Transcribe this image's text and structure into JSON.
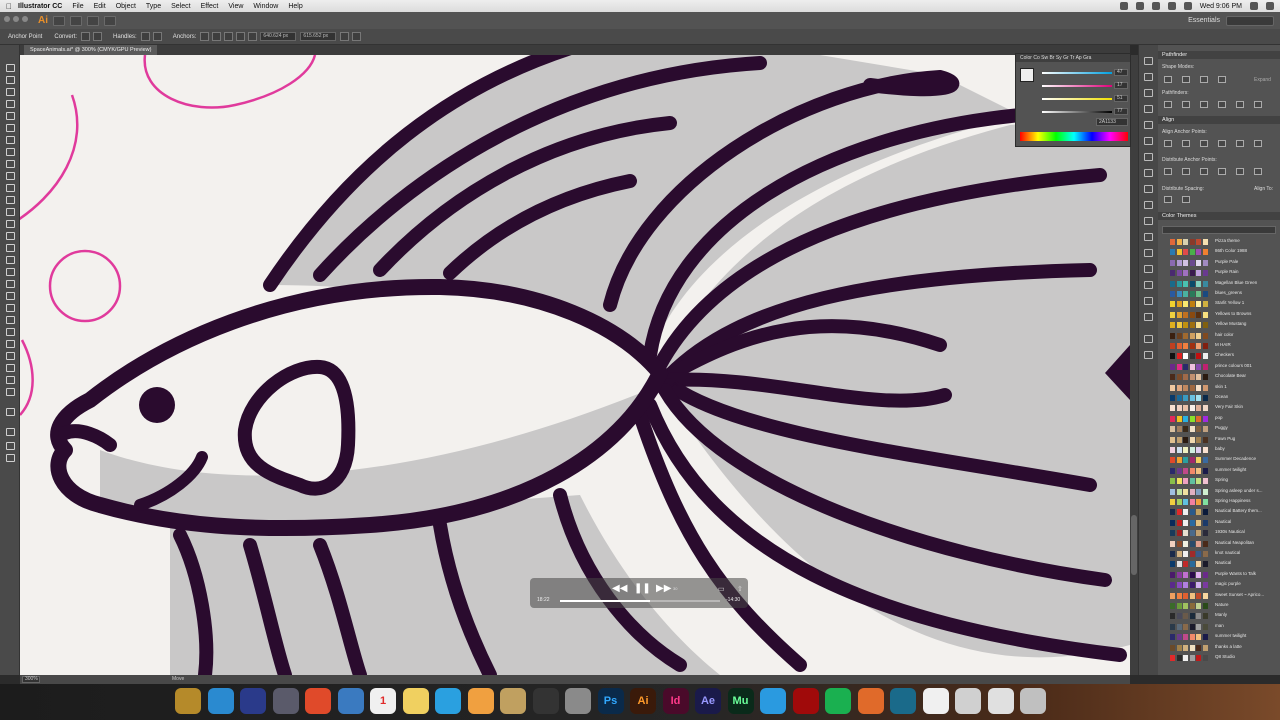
{
  "menubar": {
    "app_name": "Illustrator CC",
    "items": [
      "File",
      "Edit",
      "Object",
      "Type",
      "Select",
      "Effect",
      "View",
      "Window",
      "Help"
    ],
    "clock": "Wed 9:06 PM"
  },
  "appbar": {
    "logo": "Ai",
    "workspace": "Essentials"
  },
  "controlbar": {
    "anchor_point": "Anchor Point",
    "convert": "Convert:",
    "handles": "Handles:",
    "anchors": "Anchors:",
    "x_value": "640.624 px",
    "y_value": "615.652 px"
  },
  "document": {
    "tab_title": "SpaceAnimals.ai* @ 300% (CMYK/GPU Preview)",
    "zoom": "300%",
    "status_mode": "Move"
  },
  "color_panel": {
    "tabs": "Color  Co  Sw  Br  Sy  Gr  Tr  Ap  Gra",
    "hex": "2A1133",
    "values": [
      "47",
      "17",
      "51",
      "77"
    ]
  },
  "pathfinder": {
    "title": "Pathfinder",
    "shape_modes": "Shape Modes:",
    "expand": "Expand",
    "pathfinders": "Pathfinders:"
  },
  "align": {
    "title": "Align",
    "align_anchor": "Align Anchor Points:",
    "distribute_anchor": "Distribute Anchor Points:",
    "distribute_spacing": "Distribute Spacing:",
    "align_to": "Align To:"
  },
  "color_themes": {
    "title": "Color Themes",
    "themes": [
      {
        "name": "Pizza theme",
        "colors": [
          "#e0683a",
          "#f0b04a",
          "#d8d0b0",
          "#8a3a2a",
          "#c04a30",
          "#f4e0b0"
        ]
      },
      {
        "name": "86th Color 1988",
        "colors": [
          "#2a7ab0",
          "#f0c030",
          "#e04a4a",
          "#4ab04a",
          "#a04ab0",
          "#f08030"
        ]
      },
      {
        "name": "Purple Pale",
        "colors": [
          "#8a6ab0",
          "#b09ad0",
          "#d0c0e0",
          "#6a4a90",
          "#e0d8f0",
          "#a08ac0"
        ]
      },
      {
        "name": "Purple Rain",
        "colors": [
          "#4a2a70",
          "#7a4aa0",
          "#a070c0",
          "#3a1a50",
          "#c0a0e0",
          "#6a3a90"
        ]
      },
      {
        "name": "Magellan Blue Green",
        "colors": [
          "#1a6a8a",
          "#2a9aa0",
          "#4ac0b0",
          "#0a4a6a",
          "#80d0c0",
          "#3a8aa0"
        ]
      },
      {
        "name": "blues_greens",
        "colors": [
          "#2a5aa0",
          "#3a8ac0",
          "#4ab0a0",
          "#2a7a5a",
          "#6ac08a",
          "#1a4a80"
        ]
      },
      {
        "name": "Starlit Yellow 1",
        "colors": [
          "#f0d030",
          "#e0a020",
          "#f8e870",
          "#c08010",
          "#fff0a0",
          "#d0b040"
        ]
      },
      {
        "name": "Yellows to Browns",
        "colors": [
          "#f0d040",
          "#e0a030",
          "#c07020",
          "#8a4a10",
          "#5a3010",
          "#f8e080"
        ]
      },
      {
        "name": "Yellow Mustang",
        "colors": [
          "#e0b020",
          "#f0c840",
          "#c09010",
          "#a07010",
          "#f8e090",
          "#806010"
        ]
      },
      {
        "name": "hair color",
        "colors": [
          "#3a2010",
          "#6a4020",
          "#a06a30",
          "#d0a060",
          "#f0d090",
          "#804a20"
        ]
      },
      {
        "name": "M HAIR",
        "colors": [
          "#c04020",
          "#e06030",
          "#f08040",
          "#a03010",
          "#f0a070",
          "#802010"
        ]
      },
      {
        "name": "Checkers",
        "colors": [
          "#111111",
          "#e02020",
          "#ffffff",
          "#333333",
          "#c01010",
          "#eeeeee"
        ]
      },
      {
        "name": "prince colours 001",
        "colors": [
          "#6a2a8a",
          "#e02a8a",
          "#2a2a6a",
          "#f0c0e0",
          "#8a4ab0",
          "#c02070"
        ]
      },
      {
        "name": "Chocolate Bear",
        "colors": [
          "#4a2a1a",
          "#7a4a2a",
          "#a06a4a",
          "#c09070",
          "#e0c0a0",
          "#2a1a10"
        ]
      },
      {
        "name": "skin 1",
        "colors": [
          "#f0c8a0",
          "#e0a880",
          "#c08860",
          "#a06840",
          "#f8e0c8",
          "#d09870"
        ]
      },
      {
        "name": "Ocean",
        "colors": [
          "#0a3a6a",
          "#1a6a9a",
          "#3a9ac0",
          "#6ac0e0",
          "#a0e0f0",
          "#0a2a4a"
        ]
      },
      {
        "name": "Very Fair Skin",
        "colors": [
          "#f8e0d0",
          "#f0d0c0",
          "#e8c0a8",
          "#f8f0e8",
          "#e0b098",
          "#f0d8c8"
        ]
      },
      {
        "name": "pop",
        "colors": [
          "#e02a5a",
          "#f0c020",
          "#2ab0e0",
          "#8ae02a",
          "#e06a2a",
          "#a02ae0"
        ]
      },
      {
        "name": "Puggy",
        "colors": [
          "#d8c0a0",
          "#a08060",
          "#3a2a1a",
          "#f0e0c8",
          "#806040",
          "#c0a080"
        ]
      },
      {
        "name": "Fawn Pug",
        "colors": [
          "#e0c090",
          "#c0a070",
          "#2a1a10",
          "#f0d8b0",
          "#a08050",
          "#4a3020"
        ]
      },
      {
        "name": "baby",
        "colors": [
          "#f0d0e0",
          "#d0e0f0",
          "#f0f0c0",
          "#d0f0e0",
          "#e0d0f0",
          "#f8e0d0"
        ]
      },
      {
        "name": "Summer Decadence",
        "colors": [
          "#e04a2a",
          "#f0a030",
          "#2aa0a0",
          "#a02a6a",
          "#f0d060",
          "#3a6aa0"
        ]
      },
      {
        "name": "summer twilight",
        "colors": [
          "#2a2a6a",
          "#6a3a8a",
          "#c04a8a",
          "#f08a6a",
          "#f0c080",
          "#1a1a4a"
        ]
      },
      {
        "name": "Spring",
        "colors": [
          "#8ac04a",
          "#f0e060",
          "#f0a0c0",
          "#60c0a0",
          "#c0e080",
          "#f0c0d0"
        ]
      },
      {
        "name": "Spring asleep under s...",
        "colors": [
          "#a0c0e0",
          "#c0e0a0",
          "#f0e0a0",
          "#e0b0c0",
          "#80a0c0",
          "#d0f0d0"
        ]
      },
      {
        "name": "Spring Happiness",
        "colors": [
          "#f0d040",
          "#a0d060",
          "#60c0e0",
          "#f080a0",
          "#f0a040",
          "#80e0a0"
        ]
      },
      {
        "name": "Nautical Battery them...",
        "colors": [
          "#1a2a4a",
          "#e02a2a",
          "#f0f0f0",
          "#2a5a8a",
          "#c0a060",
          "#0a1a3a"
        ]
      },
      {
        "name": "Nautical",
        "colors": [
          "#0a2a5a",
          "#c02020",
          "#f0f0f0",
          "#2a6aa0",
          "#e0c080",
          "#1a3a6a"
        ]
      },
      {
        "name": "1930s Nautical",
        "colors": [
          "#1a3a5a",
          "#a02020",
          "#e8e0d0",
          "#4a6a8a",
          "#c0a070",
          "#2a2a3a"
        ]
      },
      {
        "name": "Nautical Neapolitan",
        "colors": [
          "#f0d0c0",
          "#8a4a2a",
          "#f0f0e0",
          "#2a4a6a",
          "#e0a090",
          "#4a2a1a"
        ]
      },
      {
        "name": "knot nautical",
        "colors": [
          "#1a2a4a",
          "#d0b080",
          "#f0f0f0",
          "#a02a2a",
          "#3a5a8a",
          "#8a6a4a"
        ]
      },
      {
        "name": "Nautical",
        "colors": [
          "#0a3a6a",
          "#e0e0e0",
          "#c02a2a",
          "#2a6a9a",
          "#f0d0a0",
          "#1a1a2a"
        ]
      },
      {
        "name": "Purple Wants to Talk",
        "colors": [
          "#4a1a6a",
          "#8a3aa0",
          "#c070d0",
          "#2a0a4a",
          "#e0b0f0",
          "#6a2a8a"
        ]
      },
      {
        "name": "magic purple",
        "colors": [
          "#5a2a8a",
          "#8a4ac0",
          "#b080e0",
          "#3a1a6a",
          "#d0b0f0",
          "#7a3aa0"
        ]
      },
      {
        "name": "Sweet Sunset ~ Aprico...",
        "colors": [
          "#f0a060",
          "#f08040",
          "#e06030",
          "#f0c080",
          "#c04a2a",
          "#f8d8a0"
        ]
      },
      {
        "name": "Nature",
        "colors": [
          "#3a6a2a",
          "#6a9a3a",
          "#a0c060",
          "#8a6a3a",
          "#c0d090",
          "#2a4a1a"
        ]
      },
      {
        "name": "Manly",
        "colors": [
          "#2a2a2a",
          "#4a4a5a",
          "#6a5a4a",
          "#1a2a3a",
          "#8a8a8a",
          "#3a3a2a"
        ]
      },
      {
        "name": "man",
        "colors": [
          "#2a3a4a",
          "#5a6a7a",
          "#8a6a4a",
          "#1a1a2a",
          "#a0a0a0",
          "#4a4a3a"
        ]
      },
      {
        "name": "summer twilight",
        "colors": [
          "#2a2a6a",
          "#6a3a8a",
          "#c04a8a",
          "#f08a6a",
          "#f0c080",
          "#1a1a4a"
        ]
      },
      {
        "name": "thanks a latte",
        "colors": [
          "#6a4a2a",
          "#a0804a",
          "#d0b080",
          "#f0e0c0",
          "#4a2a1a",
          "#c0a070"
        ]
      },
      {
        "name": "Q8 Studio",
        "colors": [
          "#e02a2a",
          "#2a2a2a",
          "#f0f0f0",
          "#a0a0a0",
          "#c01a1a",
          "#4a4a4a"
        ]
      }
    ]
  },
  "video": {
    "elapsed": "18:22",
    "remaining": "-14:30",
    "skip_label": "30",
    "progress": 0.56
  },
  "artwork": {
    "outline_color": "#2a0b2e",
    "shadow_color": "#c9c8c8",
    "body_color": "#f3f1ee",
    "pink_color": "#e03a9c"
  },
  "dock": {
    "apps": [
      {
        "label": "",
        "color": "#b58a2a"
      },
      {
        "label": "",
        "color": "#2a8ad0"
      },
      {
        "label": "",
        "color": "#2a3a8a"
      },
      {
        "label": "",
        "color": "#5a5a6a"
      },
      {
        "label": "",
        "color": "#e04a2a"
      },
      {
        "label": "",
        "color": "#3a7ac0"
      },
      {
        "label": "1",
        "color": "#f0f0f0"
      },
      {
        "label": "",
        "color": "#f0d060"
      },
      {
        "label": "",
        "color": "#2aa0e0"
      },
      {
        "label": "",
        "color": "#f0a040"
      },
      {
        "label": "",
        "color": "#c0a060"
      },
      {
        "label": "",
        "color": "#333333"
      },
      {
        "label": "",
        "color": "#8a8a8a"
      },
      {
        "label": "Ps",
        "color": "#0a2a4a"
      },
      {
        "label": "Ai",
        "color": "#3a1a0a"
      },
      {
        "label": "Id",
        "color": "#4a0a2a"
      },
      {
        "label": "Ae",
        "color": "#1a1a4a"
      },
      {
        "label": "Mu",
        "color": "#0a2a1a"
      },
      {
        "label": "",
        "color": "#2a9ae0"
      },
      {
        "label": "",
        "color": "#a00a0a"
      },
      {
        "label": "",
        "color": "#1ab050"
      },
      {
        "label": "",
        "color": "#e06a2a"
      },
      {
        "label": "",
        "color": "#1a6a8a"
      },
      {
        "label": "",
        "color": "#f0f0f0"
      },
      {
        "label": "",
        "color": "#d0d0d0"
      },
      {
        "label": "",
        "color": "#e0e0e0"
      },
      {
        "label": "",
        "color": "#c0c0c0"
      }
    ]
  }
}
